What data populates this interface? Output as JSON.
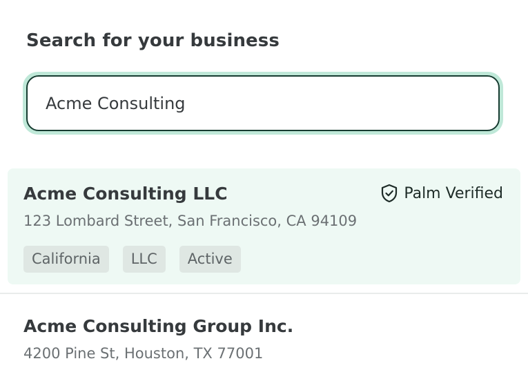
{
  "search": {
    "label": "Search for your business",
    "value": "Acme Consulting"
  },
  "results": [
    {
      "name": "Acme Consulting LLC",
      "address": "123 Lombard Street, San Francisco, CA 94109",
      "badge": "Palm Verified",
      "badge_icon": "shield-check-icon",
      "tags": [
        "California",
        "LLC",
        "Active"
      ],
      "selected": true
    },
    {
      "name": "Acme Consulting Group Inc.",
      "address": "4200 Pine St, Houston, TX 77001",
      "selected": false
    }
  ],
  "colors": {
    "selected_bg": "#eef9f4",
    "focus_ring": "#bfe8d8",
    "input_border": "#163b30",
    "tag_bg": "#dfe7e3"
  }
}
